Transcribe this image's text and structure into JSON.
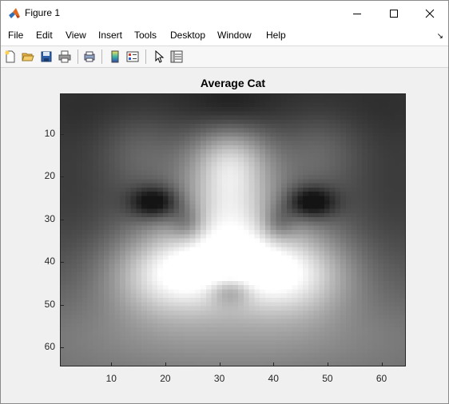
{
  "window": {
    "title": "Figure 1",
    "controls": [
      "minimize",
      "maximize",
      "close"
    ]
  },
  "menubar": {
    "items": [
      "File",
      "Edit",
      "View",
      "Insert",
      "Tools",
      "Desktop",
      "Window",
      "Help"
    ]
  },
  "toolbar": {
    "buttons": [
      "new-figure-icon",
      "open-file-icon",
      "save-icon",
      "print-icon",
      "print-preview-icon",
      "colorbar-icon",
      "legend-icon",
      "edit-plot-icon",
      "property-inspector-icon"
    ]
  },
  "chart_data": {
    "type": "heatmap",
    "title": "Average Cat",
    "colormap": "gray",
    "x_range": [
      0.5,
      64.5
    ],
    "y_range": [
      0.5,
      64.5
    ],
    "y_reversed": true,
    "xticks": [
      10,
      20,
      30,
      40,
      50,
      60
    ],
    "yticks": [
      10,
      20,
      30,
      40,
      50,
      60
    ]
  }
}
